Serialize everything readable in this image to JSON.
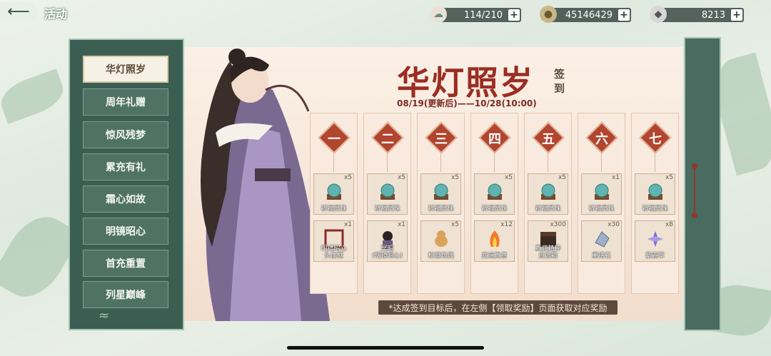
{
  "header": {
    "title": "活动",
    "back_icon": "arrow-left-icon"
  },
  "resources": [
    {
      "name": "stamina",
      "icon": "cloud-icon",
      "value": "114/210"
    },
    {
      "name": "coins",
      "icon": "coin-stack-icon",
      "value": "45146429"
    },
    {
      "name": "jade",
      "icon": "ingot-icon",
      "value": "8213"
    }
  ],
  "sidebar": {
    "items": [
      {
        "label": "华灯照岁",
        "active": true
      },
      {
        "label": "周年礼赠",
        "active": false
      },
      {
        "label": "惊风残梦",
        "active": false
      },
      {
        "label": "累充有礼",
        "active": false
      },
      {
        "label": "霜心如故",
        "active": false
      },
      {
        "label": "明镜昭心",
        "active": false
      },
      {
        "label": "首充重置",
        "active": false
      },
      {
        "label": "列星巅峰",
        "active": false
      }
    ]
  },
  "event": {
    "title": "华灯照岁",
    "subtitle": "签到",
    "date_range": "08/19(更新后)——10/28(10:00)",
    "footnote": "*达成签到目标后，在左侧【领取奖励】页面获取对应奖励"
  },
  "days": [
    {
      "day": "一",
      "reward1": {
        "name": "祈福灵珠",
        "qty": "x5"
      },
      "reward2": {
        "name": "明镜昭心\n头像框",
        "qty": "x1"
      }
    },
    {
      "day": "二",
      "reward1": {
        "name": "祈福灵珠",
        "qty": "x5"
      },
      "reward2": {
        "name": "冥昭\n(明镜昭心)",
        "qty": "x1"
      }
    },
    {
      "day": "三",
      "reward1": {
        "name": "祈福灵珠",
        "qty": "x5"
      },
      "reward2": {
        "name": "松鼠玩偶",
        "qty": "x5"
      }
    },
    {
      "day": "四",
      "reward1": {
        "name": "祈福灵珠",
        "qty": "x5"
      },
      "reward2": {
        "name": "武道真意",
        "qty": "x12"
      }
    },
    {
      "day": "五",
      "reward1": {
        "name": "祈福灵珠",
        "qty": "x5"
      },
      "reward2": {
        "name": "真武精粹\n自选箱",
        "qty": "x300"
      }
    },
    {
      "day": "六",
      "reward1": {
        "name": "祈福灵珠",
        "qty": "x1"
      },
      "reward2": {
        "name": "重铸石",
        "qty": "x30"
      }
    },
    {
      "day": "七",
      "reward1": {
        "name": "祈福灵珠",
        "qty": "x5"
      },
      "reward2": {
        "name": "紫霞萃",
        "qty": "x8"
      }
    }
  ],
  "colors": {
    "accent_red": "#b2452f",
    "title_red": "#9b2d22",
    "sidebar_green": "#3a5f52"
  }
}
